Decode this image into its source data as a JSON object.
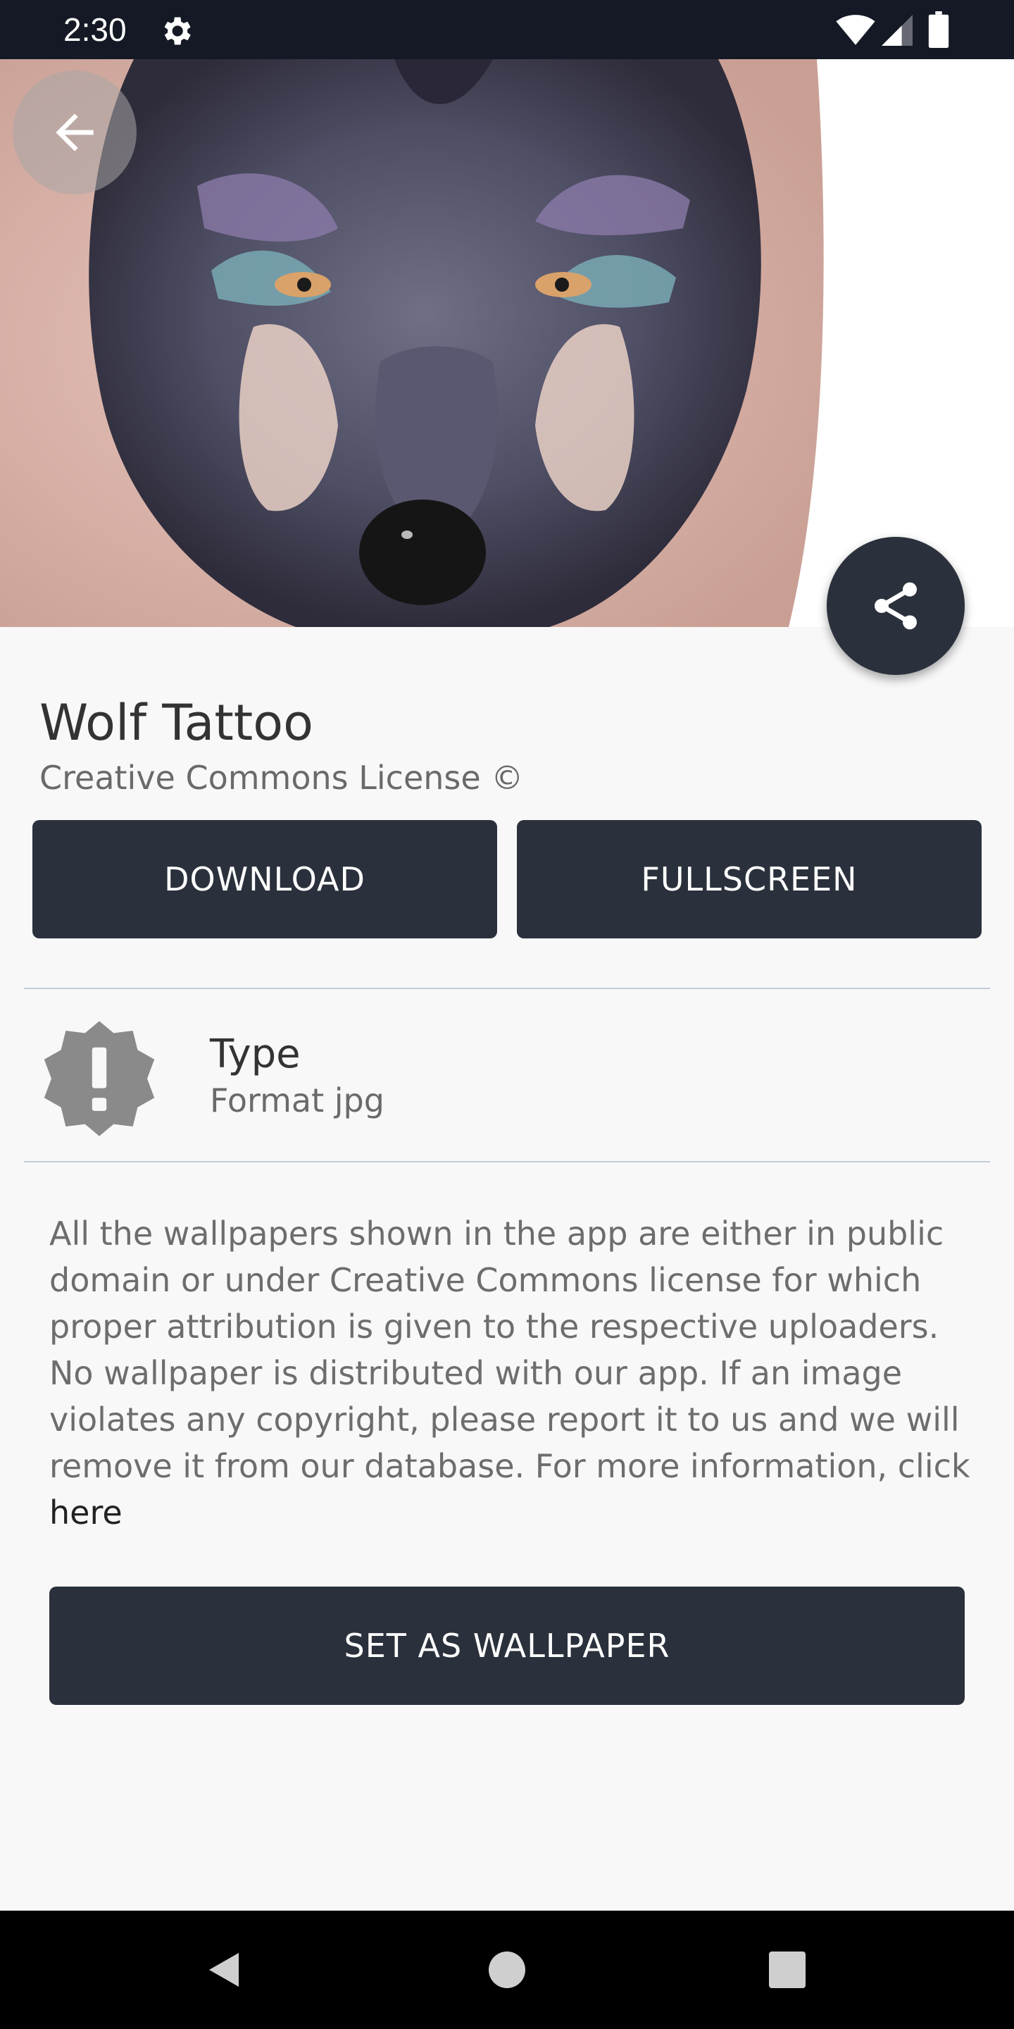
{
  "status_bar": {
    "time": "2:30"
  },
  "hero": {
    "image_subject": "wolf tattoo artwork"
  },
  "wallpaper": {
    "title": "Wolf Tattoo",
    "license": "Creative Commons License ©"
  },
  "actions": {
    "download_label": "DOWNLOAD",
    "fullscreen_label": "FULLSCREEN",
    "set_wallpaper_label": "SET AS WALLPAPER"
  },
  "info": {
    "type_label": "Type",
    "type_value": "Format jpg"
  },
  "disclaimer": {
    "text": "All the wallpapers shown in the app are either in public domain or under Creative Commons license for which proper attribution is given to the respective uploaders. No wallpaper is distributed with our app. If an image violates any copyright, please report it to us and we will remove it from our database. For more information, click ",
    "link_text": "here"
  },
  "icons": {
    "status": [
      "gear-icon",
      "wifi-icon",
      "signal-icon",
      "battery-icon"
    ],
    "back": "arrow-left-icon",
    "share": "share-icon",
    "type": "alert-badge-icon",
    "nav": [
      "nav-back-icon",
      "nav-home-icon",
      "nav-recents-icon"
    ]
  },
  "colors": {
    "primary": "#2a313c",
    "status_bar": "#141925",
    "background": "#f8f8f8",
    "divider": "#c3ccd8"
  }
}
